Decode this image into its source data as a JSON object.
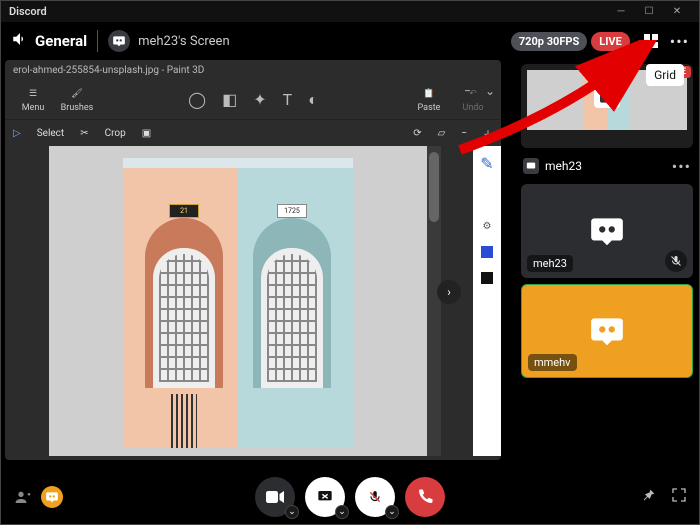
{
  "appTitle": "Discord",
  "channel": "General",
  "screenTitle": "meh23's Screen",
  "stream": {
    "quality": "720p 30FPS",
    "live": "LIVE"
  },
  "tooltip": "Grid",
  "paint3d": {
    "windowTitle": "erol-ahmed-255854-unsplash.jpg - Paint 3D",
    "menu": "Menu",
    "brushes": "Brushes",
    "paste": "Paste",
    "undo": "Undo",
    "select": "Select",
    "crop": "Crop",
    "plaqueLeft": "21",
    "plaqueRight": "1725"
  },
  "participants": {
    "screenUser": "meh23",
    "tile1": "meh23",
    "tile2": "mmehv",
    "liveBadge": "LIVE"
  },
  "colors": {
    "live": "#d83c3e",
    "orange": "#f0a020",
    "darkTile": "#2b2d31"
  }
}
